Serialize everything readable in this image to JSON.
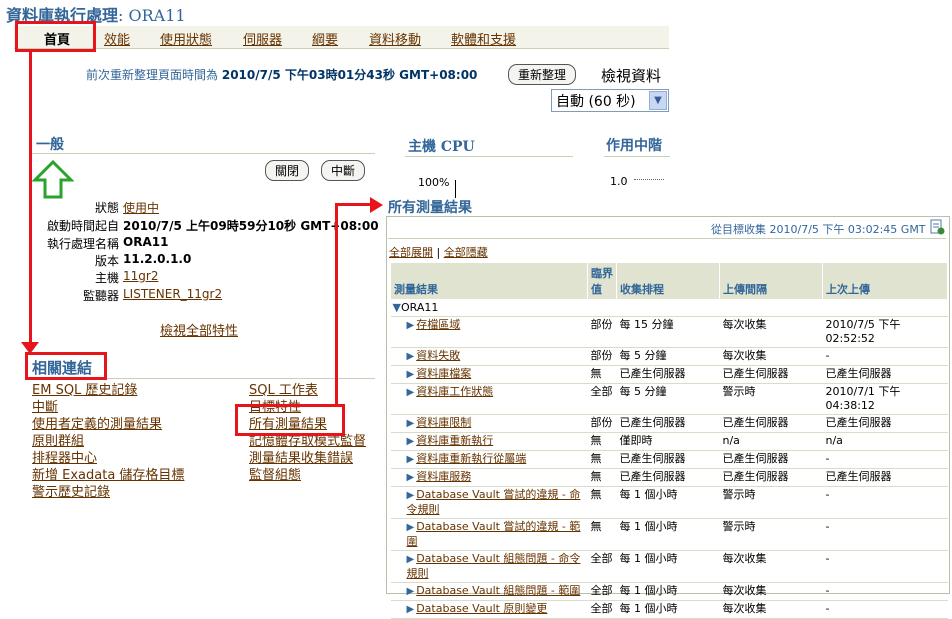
{
  "title": {
    "main": "資料庫執行處理",
    "sep": ": ",
    "db": "ORA11"
  },
  "tabs": [
    {
      "label": "首頁",
      "active": true
    },
    {
      "label": "效能"
    },
    {
      "label": "使用狀態"
    },
    {
      "label": "伺服器"
    },
    {
      "label": "綱要"
    },
    {
      "label": "資料移動"
    },
    {
      "label": "軟體和支援"
    }
  ],
  "refresh": {
    "text": "前次重新整理頁面時間為",
    "time": "2010/7/5 下午03時01分43秒 GMT+08:00",
    "button": "重新整理",
    "view_label": "檢視資料",
    "select_value": "自動 (60 秒)"
  },
  "general": {
    "heading": "一般",
    "close_btn": "關閉",
    "interrupt_btn": "中斷",
    "props": [
      {
        "label": "狀態",
        "value": "使用中",
        "link": true
      },
      {
        "label": "啟動時間起自",
        "value": "2010/7/5 上午09時59分10秒 GMT+08:00",
        "bold": true
      },
      {
        "label": "執行處理名稱",
        "value": "ORA11",
        "bold": true
      },
      {
        "label": "版本",
        "value": "11.2.0.1.0",
        "bold": true
      },
      {
        "label": "主機",
        "value": "11gr2",
        "link": true
      },
      {
        "label": "監聽器",
        "value": "LISTENER_11gr2",
        "link": true
      }
    ],
    "view_all": "檢視全部特性"
  },
  "host_cpu": {
    "heading": "主機 CPU",
    "axis_label": "100%"
  },
  "active_sessions": {
    "heading": "作用中階",
    "axis_label": "1.0"
  },
  "related": {
    "heading": "相關連結",
    "col1": [
      "EM SQL 歷史記錄",
      "中斷",
      "使用者定義的測量結果",
      "原則群組",
      "排程器中心",
      "新增 Exadata 儲存格目標",
      "警示歷史記錄"
    ],
    "col2": [
      "SQL 工作表",
      "目標特性",
      "所有測量結果",
      "記憶體存取模式監督",
      "測量結果收集錯誤",
      "監督組態"
    ]
  },
  "all_metrics": {
    "heading": "所有測量結果",
    "collected": "從目標收集 2010/7/5 下午 03:02:45 GMT",
    "expand_all": "全部展開",
    "collapse_all": "全部隱藏",
    "columns": [
      "測量結果",
      "臨界值",
      "收集排程",
      "上傳間隔",
      "上次上傳"
    ],
    "root": "ORA11",
    "rows": [
      {
        "name": "存檔區域",
        "thr": "部份",
        "sched": "每 15 分鐘",
        "upload": "每次收集",
        "last": "2010/7/5 下午 02:52:52"
      },
      {
        "name": "資料失敗",
        "thr": "部份",
        "sched": "每 5 分鐘",
        "upload": "每次收集",
        "last": "-"
      },
      {
        "name": "資料庫檔案",
        "thr": "無",
        "sched": "已產生伺服器",
        "upload": "已產生伺服器",
        "last": "已產生伺服器"
      },
      {
        "name": "資料庫工作狀態",
        "thr": "全部",
        "sched": "每 5 分鐘",
        "upload": "警示時",
        "last": "2010/7/1 下午 04:38:12"
      },
      {
        "name": "資料庫限制",
        "thr": "部份",
        "sched": "已產生伺服器",
        "upload": "已產生伺服器",
        "last": "已產生伺服器"
      },
      {
        "name": "資料庫重新執行",
        "thr": "無",
        "sched": "僅即時",
        "upload": "n/a",
        "last": "n/a"
      },
      {
        "name": "資料庫重新執行從屬端",
        "thr": "無",
        "sched": "已產生伺服器",
        "upload": "已產生伺服器",
        "last": "-"
      },
      {
        "name": "資料庫服務",
        "thr": "無",
        "sched": "已產生伺服器",
        "upload": "已產生伺服器",
        "last": "已產生伺服器"
      },
      {
        "name": "Database Vault 嘗試的違規 - 命令規則",
        "thr": "無",
        "sched": "每 1 個小時",
        "upload": "警示時",
        "last": "-"
      },
      {
        "name": "Database Vault 嘗試的違規 - 範圍",
        "thr": "無",
        "sched": "每 1 個小時",
        "upload": "警示時",
        "last": "-"
      },
      {
        "name": "Database Vault 組態問題 - 命令規則",
        "thr": "全部",
        "sched": "每 1 個小時",
        "upload": "每次收集",
        "last": "-"
      },
      {
        "name": "Database Vault 組態問題 - 範圍",
        "thr": "全部",
        "sched": "每 1 個小時",
        "upload": "每次收集",
        "last": "-"
      },
      {
        "name": "Database Vault 原則變更",
        "thr": "全部",
        "sched": "每 1 個小時",
        "upload": "每次收集",
        "last": "-"
      }
    ]
  }
}
